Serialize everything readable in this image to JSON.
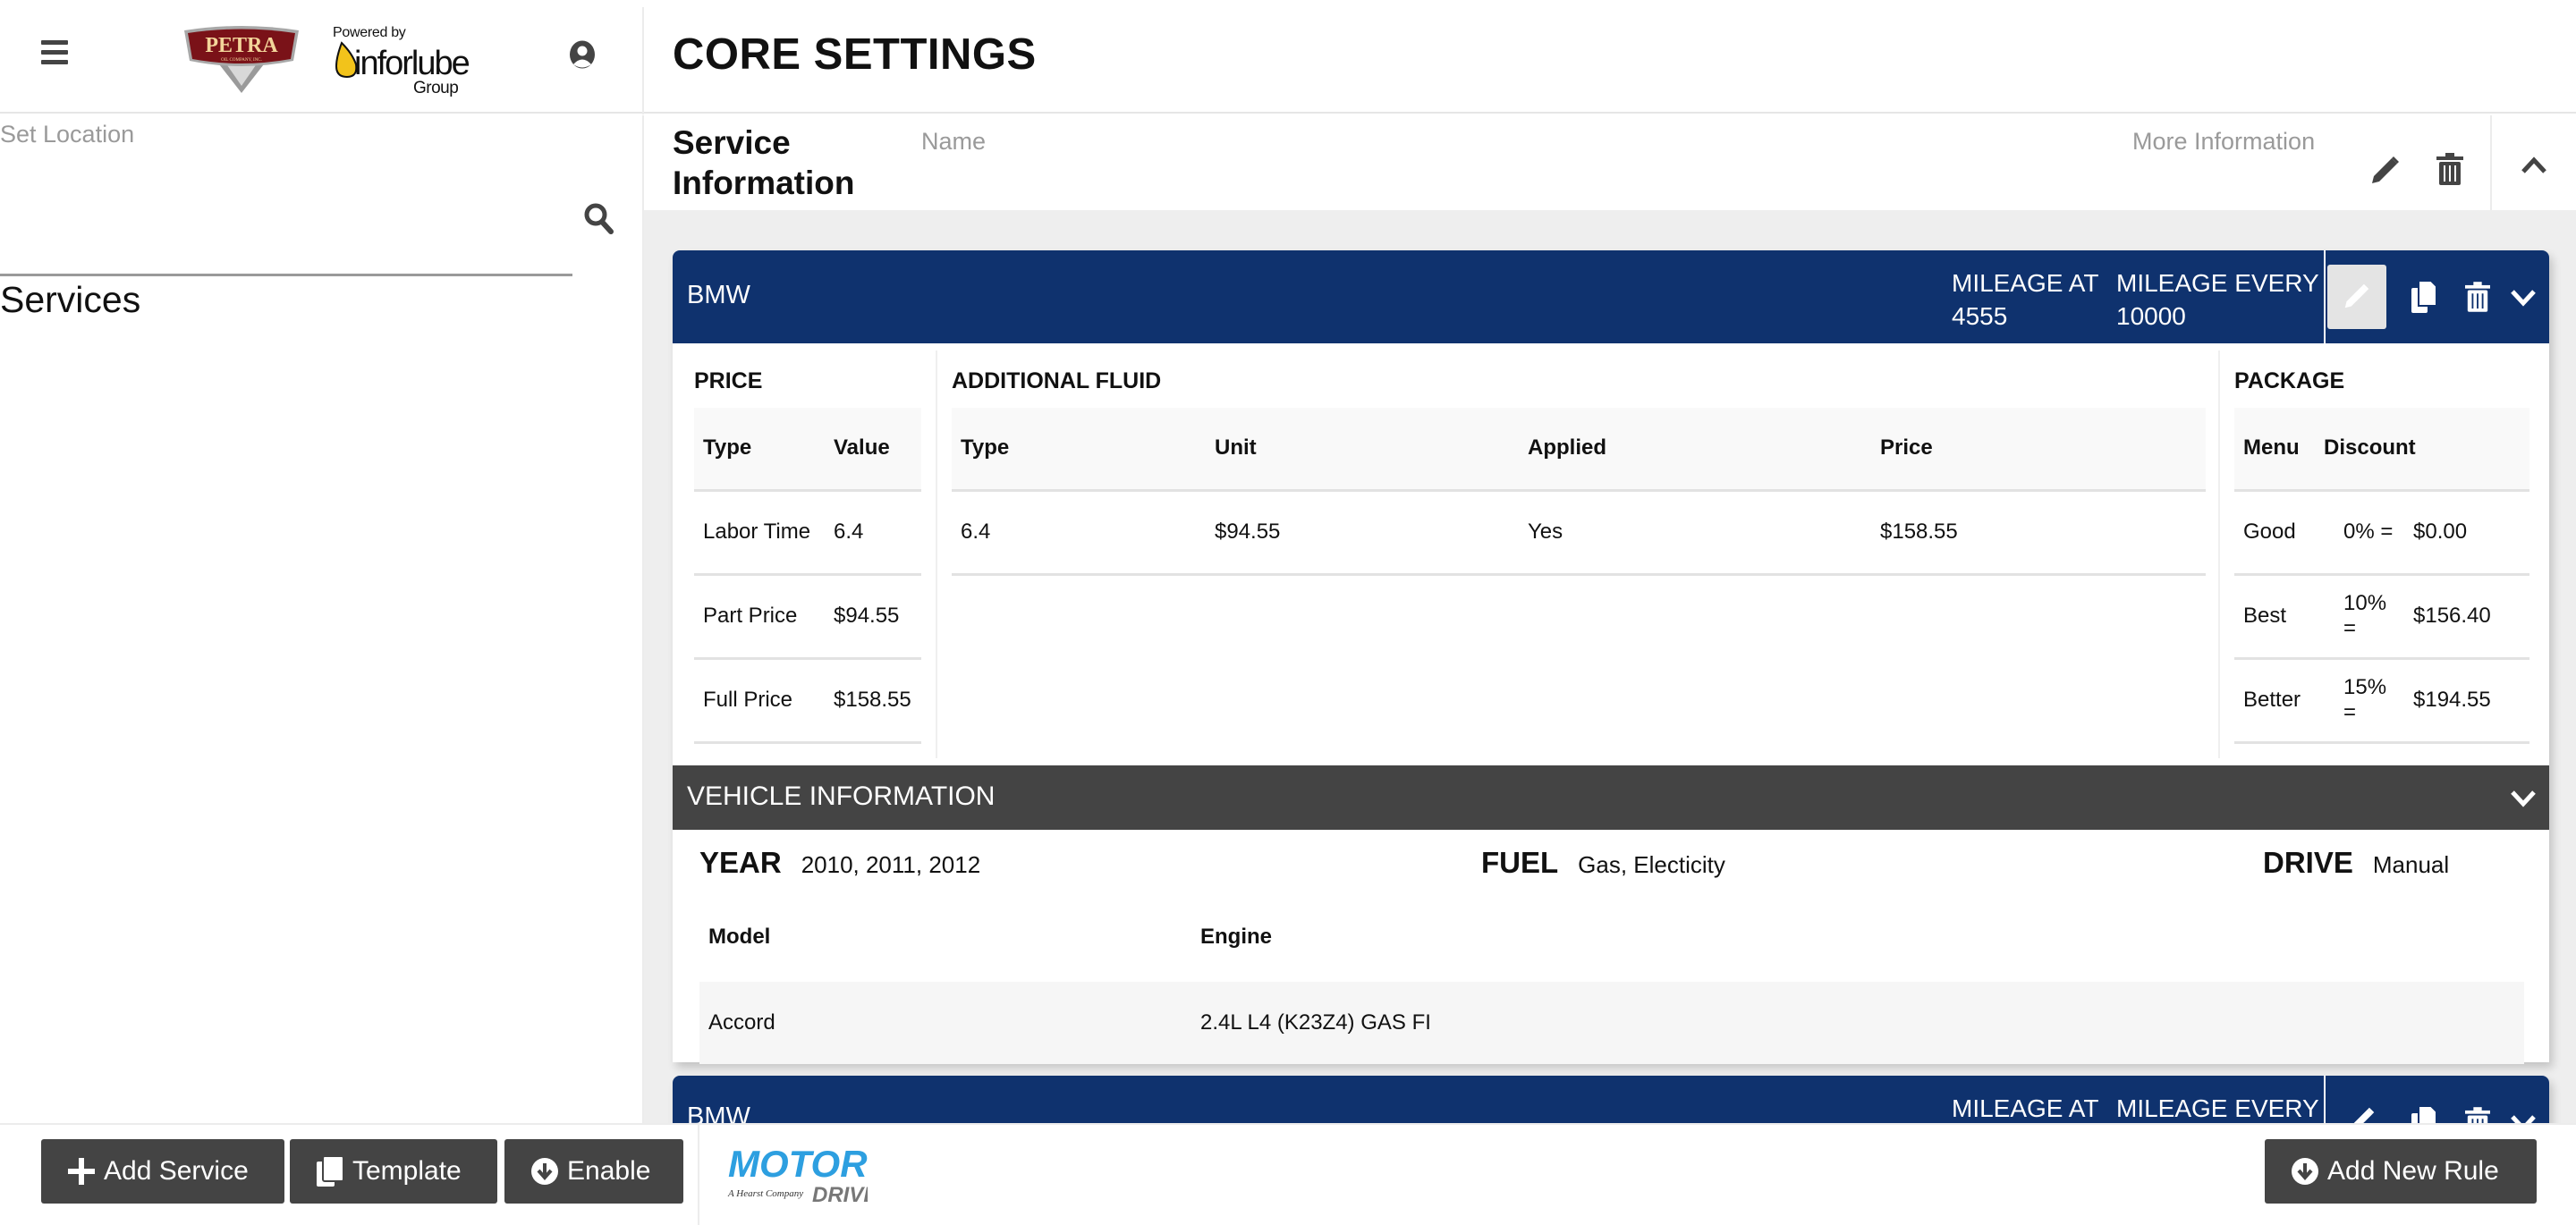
{
  "header": {
    "menu_icon": "hamburger-menu-icon",
    "logo_text": "PETRA",
    "logo_subtext": "OIL COMPANY, INC.",
    "powered_by": "Powered by",
    "partner_brand": "inforlube",
    "partner_group": "Group",
    "user_icon": "user-circle-icon",
    "page_title": "CORE SETTINGS"
  },
  "sidebar": {
    "location_label": "Set Location",
    "location_value": "",
    "search_icon": "search-icon",
    "services_heading": "Services"
  },
  "service_info": {
    "title_line1": "Service",
    "title_line2": "Information",
    "name_label": "Name",
    "more_label": "More Information",
    "edit_icon": "pencil-icon",
    "delete_icon": "trash-icon",
    "collapse_icon": "chevron-up-icon"
  },
  "colors": {
    "card_header": "#0f326e",
    "vehicle_bar": "#444444",
    "button": "#444444",
    "page_bg": "#eeeeee"
  },
  "rules": [
    {
      "make": "BMW",
      "mileage_at_label": "MILEAGE AT",
      "mileage_at_value": "4555",
      "mileage_every_label": "MILEAGE EVERY",
      "mileage_every_value": "10000",
      "price": {
        "title": "PRICE",
        "headers": [
          "Type",
          "Value"
        ],
        "rows": [
          [
            "Labor Time",
            "6.4"
          ],
          [
            "Part Price",
            "$94.55"
          ],
          [
            "Full Price",
            "$158.55"
          ]
        ]
      },
      "additional_fluid": {
        "title": "ADDITIONAL FLUID",
        "headers": [
          "Type",
          "Unit",
          "Applied",
          "Price"
        ],
        "rows": [
          [
            "6.4",
            "$94.55",
            "Yes",
            "$158.55"
          ]
        ]
      },
      "package": {
        "title": "PACKAGE",
        "headers": [
          "Menu",
          "Discount"
        ],
        "rows": [
          [
            "Good",
            "0% =",
            "$0.00"
          ],
          [
            "Best",
            "10% =",
            "$156.40"
          ],
          [
            "Better",
            "15% =",
            "$194.55"
          ]
        ]
      },
      "vehicle": {
        "title": "VEHICLE INFORMATION",
        "year_label": "YEAR",
        "year_value": "2010, 2011, 2012",
        "fuel_label": "FUEL",
        "fuel_value": "Gas, Electicity",
        "drive_label": "DRIVE",
        "drive_value": "Manual",
        "headers": [
          "Model",
          "Engine"
        ],
        "rows": [
          [
            "Accord",
            "2.4L L4 (K23Z4) GAS FI"
          ]
        ]
      }
    },
    {
      "make": "BMW",
      "mileage_at_label": "MILEAGE AT",
      "mileage_every_label": "MILEAGE EVERY"
    }
  ],
  "footer": {
    "add_service": "Add Service",
    "template": "Template",
    "enable": "Enable",
    "motor_logo_text": "MOTOR",
    "motor_logo_sub": "A Hearst Company",
    "motor_logo_driven": "DRIVEN",
    "add_new_rule": "Add New Rule"
  }
}
